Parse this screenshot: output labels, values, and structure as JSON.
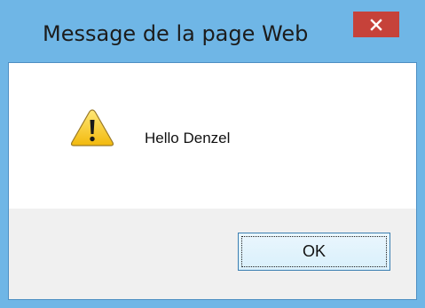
{
  "dialog": {
    "title": "Message de la page Web",
    "message": "Hello Denzel",
    "ok_label": "OK",
    "icon": "warning-icon",
    "close_icon": "close-icon"
  },
  "colors": {
    "frame": "#6fb6e6",
    "close_button": "#c6423a",
    "footer": "#f0f0f0",
    "ok_border": "#3c7fb1"
  }
}
